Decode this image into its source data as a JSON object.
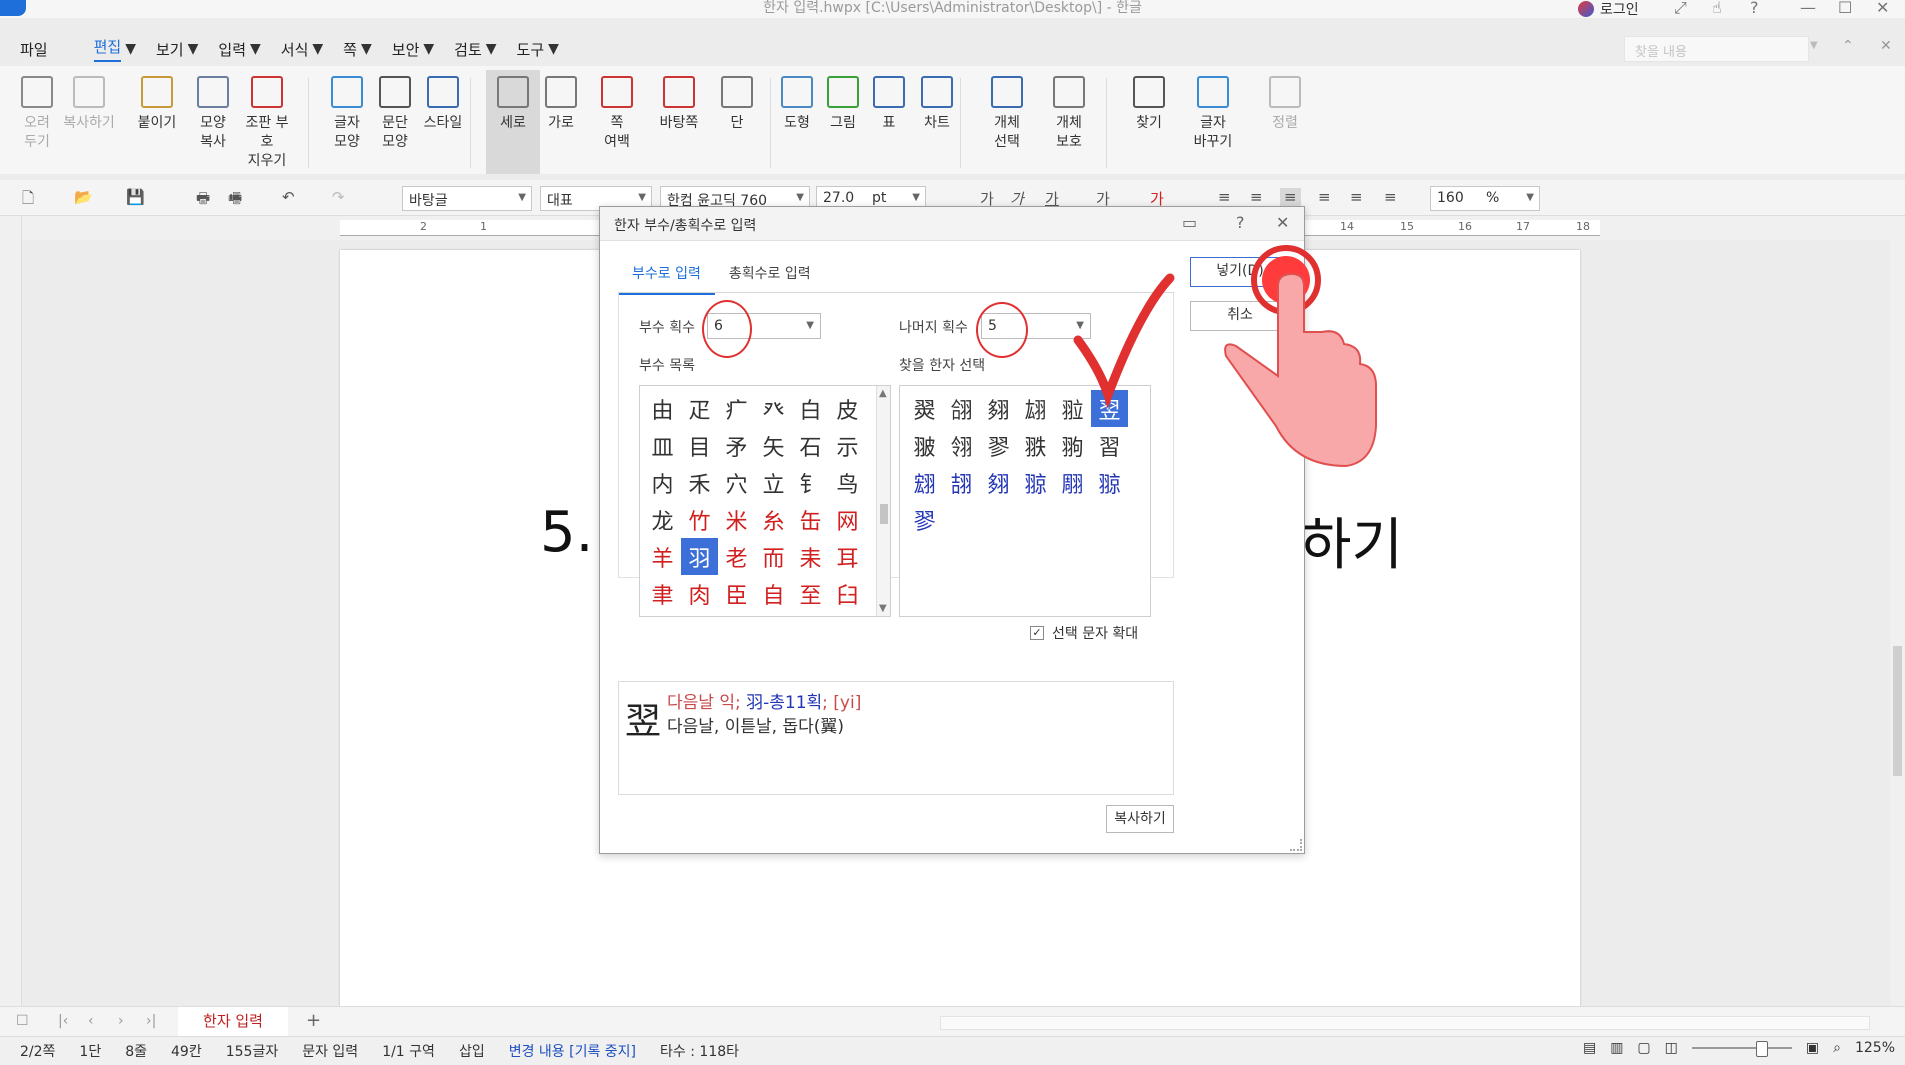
{
  "window": {
    "title": "한자 입력.hwpx [C:\\Users\\Administrator\\Desktop\\] - 한글",
    "login": "로그인"
  },
  "menu": {
    "items": [
      "파일",
      "편집",
      "보기",
      "입력",
      "서식",
      "쪽",
      "보안",
      "검토",
      "도구"
    ],
    "active": "편집",
    "search_placeholder": "찾을 내용"
  },
  "ribbon": {
    "buttons": [
      {
        "label": "오려\n두기",
        "icon": "scissors-icon",
        "disabled": true
      },
      {
        "label": "복사하기",
        "icon": "copy-icon",
        "disabled": true
      },
      {
        "label": "붙이기",
        "icon": "paste-icon"
      },
      {
        "label": "모양\n복사",
        "icon": "format-paint-icon"
      },
      {
        "label": "조판 부호\n지우기",
        "icon": "clear-code-icon"
      },
      {
        "label": "글자\n모양",
        "icon": "char-shape-icon"
      },
      {
        "label": "문단\n모양",
        "icon": "para-shape-icon"
      },
      {
        "label": "스타일",
        "icon": "style-icon"
      },
      {
        "label": "세로",
        "icon": "portrait-icon",
        "selected": true
      },
      {
        "label": "가로",
        "icon": "landscape-icon"
      },
      {
        "label": "쪽\n여백",
        "icon": "margin-icon"
      },
      {
        "label": "바탕쪽",
        "icon": "master-page-icon"
      },
      {
        "label": "단",
        "icon": "columns-icon"
      },
      {
        "label": "도형",
        "icon": "shape-icon"
      },
      {
        "label": "그림",
        "icon": "picture-icon"
      },
      {
        "label": "표",
        "icon": "table-icon"
      },
      {
        "label": "차트",
        "icon": "chart-icon"
      },
      {
        "label": "개체\n선택",
        "icon": "object-select-icon"
      },
      {
        "label": "개체\n보호",
        "icon": "object-protect-icon"
      },
      {
        "label": "찾기",
        "icon": "binoculars-icon"
      },
      {
        "label": "글자\n바꾸기",
        "icon": "char-convert-icon"
      },
      {
        "label": "정렬",
        "icon": "sort-icon",
        "disabled": true
      }
    ]
  },
  "toolbar": {
    "style": "바탕글",
    "lang": "대표",
    "font": "한컴 윤고딕 760",
    "size": "27.0",
    "size_unit": "pt",
    "zoom_percent": "160",
    "zoom_unit": "%"
  },
  "ruler": {
    "marks": [
      "2",
      "1",
      "1",
      "14",
      "15",
      "16",
      "17",
      "18"
    ]
  },
  "document": {
    "text_left": "5.",
    "text_right": "하기"
  },
  "dialog": {
    "title": "한자 부수/총획수로 입력",
    "tabs": [
      "부수로 입력",
      "총획수로 입력"
    ],
    "radical_strokes_label": "부수 획수",
    "radical_strokes_value": "6",
    "remaining_strokes_label": "나머지 획수",
    "remaining_strokes_value": "5",
    "radical_list_label": "부수 목록",
    "hanja_select_label": "찾을 한자 선택",
    "radicals": [
      {
        "c": "由",
        "t": "n"
      },
      {
        "c": "疋",
        "t": "n"
      },
      {
        "c": "疒",
        "t": "n"
      },
      {
        "c": "癶",
        "t": "n"
      },
      {
        "c": "白",
        "t": "n"
      },
      {
        "c": "皮",
        "t": "n"
      },
      {
        "c": "皿",
        "t": "n"
      },
      {
        "c": "目",
        "t": "n"
      },
      {
        "c": "矛",
        "t": "n"
      },
      {
        "c": "矢",
        "t": "n"
      },
      {
        "c": "石",
        "t": "n"
      },
      {
        "c": "示",
        "t": "n"
      },
      {
        "c": "内",
        "t": "n"
      },
      {
        "c": "禾",
        "t": "n"
      },
      {
        "c": "穴",
        "t": "n"
      },
      {
        "c": "立",
        "t": "n"
      },
      {
        "c": "钅",
        "t": "n"
      },
      {
        "c": "鸟",
        "t": "n"
      },
      {
        "c": "龙",
        "t": "n"
      },
      {
        "c": "竹",
        "t": "r"
      },
      {
        "c": "米",
        "t": "r"
      },
      {
        "c": "糸",
        "t": "r"
      },
      {
        "c": "缶",
        "t": "r"
      },
      {
        "c": "网",
        "t": "r"
      },
      {
        "c": "羊",
        "t": "r"
      },
      {
        "c": "羽",
        "t": "s"
      },
      {
        "c": "老",
        "t": "r"
      },
      {
        "c": "而",
        "t": "r"
      },
      {
        "c": "耒",
        "t": "r"
      },
      {
        "c": "耳",
        "t": "r"
      },
      {
        "c": "聿",
        "t": "r"
      },
      {
        "c": "肉",
        "t": "r"
      },
      {
        "c": "臣",
        "t": "r"
      },
      {
        "c": "自",
        "t": "r"
      },
      {
        "c": "至",
        "t": "r"
      },
      {
        "c": "臼",
        "t": "r"
      }
    ],
    "hanja": [
      {
        "c": "翜",
        "t": "n"
      },
      {
        "c": "翖",
        "t": "n"
      },
      {
        "c": "翗",
        "t": "n"
      },
      {
        "c": "翃",
        "t": "n"
      },
      {
        "c": "翋",
        "t": "n"
      },
      {
        "c": "翌",
        "t": "s"
      },
      {
        "c": "翍",
        "t": "n"
      },
      {
        "c": "翎",
        "t": "n"
      },
      {
        "c": "翏",
        "t": "n"
      },
      {
        "c": "翐",
        "t": "n"
      },
      {
        "c": "翑",
        "t": "n"
      },
      {
        "c": "習",
        "t": "n"
      },
      {
        "c": "翝",
        "t": "b"
      },
      {
        "c": "翓",
        "t": "b"
      },
      {
        "c": "翗",
        "t": "b"
      },
      {
        "c": "翞",
        "t": "b"
      },
      {
        "c": "翢",
        "t": "b"
      },
      {
        "c": "翞",
        "t": "b"
      },
      {
        "c": "翏",
        "t": "b"
      }
    ],
    "enlarge_label": "선택 문자 확대",
    "enlarge_checked": true,
    "info_char": "翌",
    "info_meaning": "다음날 익",
    "info_radical": "羽-총11획",
    "info_reading": "[yi]",
    "info_desc": "다음날, 이튿날, 돕다(翼)",
    "copy_button": "복사하기",
    "insert_button": "넣기(D)",
    "cancel_button": "취소"
  },
  "tabbar": {
    "doc_tab": "한자 입력",
    "add_tab": "+"
  },
  "status": {
    "page": "2/2쪽",
    "column": "1단",
    "line": "8줄",
    "char_col": "49칸",
    "char_count": "155글자",
    "mode": "문자 입력",
    "section": "1/1 구역",
    "insert": "삽입",
    "track_changes": "변경 내용 [기록 중지]",
    "typing_speed": "타수 : 118타",
    "zoom": "125%"
  },
  "colors": {
    "accent": "#1e6fd9",
    "radical_highlight": "#d02020",
    "hanja_blue": "#2235b5",
    "selection": "#3d6fd8",
    "annotation": "#e03030"
  }
}
